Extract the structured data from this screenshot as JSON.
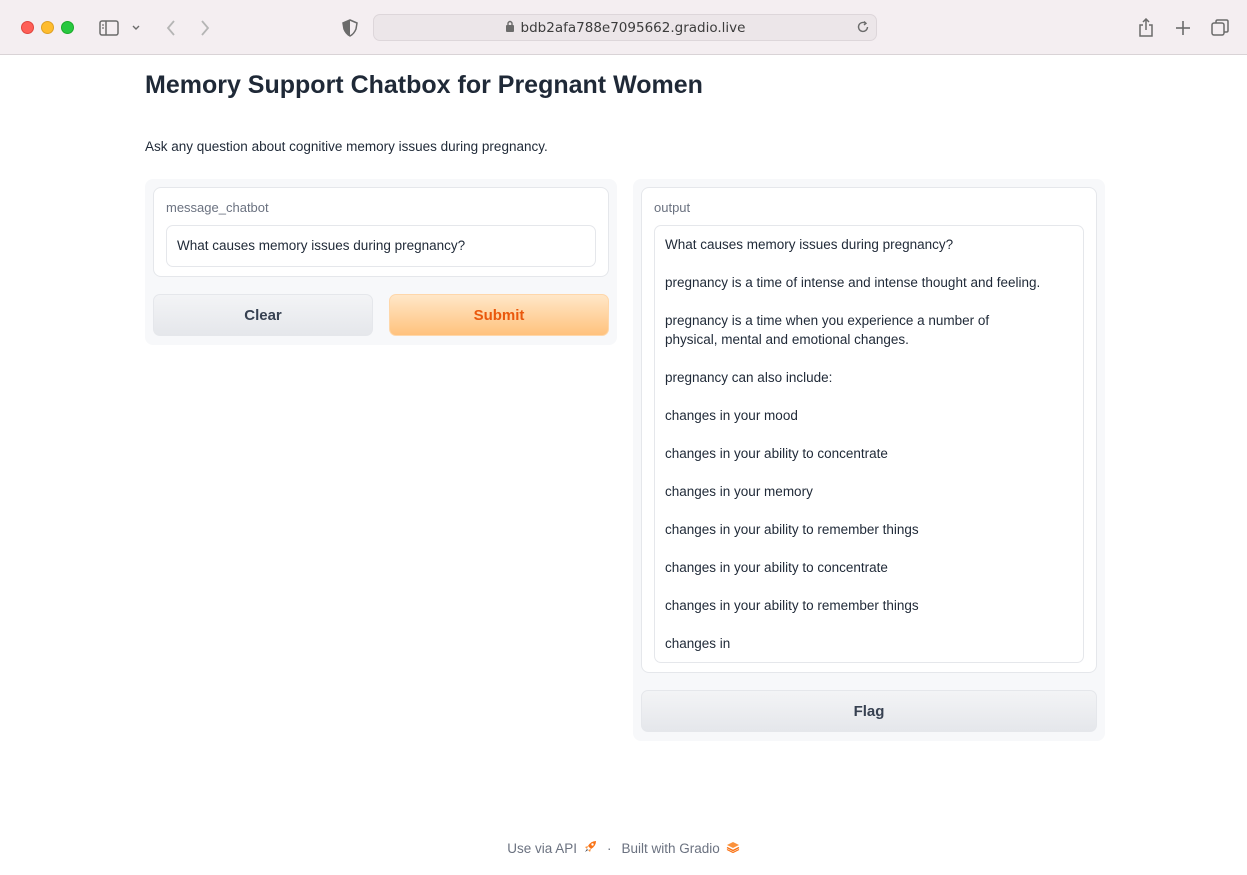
{
  "browser": {
    "url": "bdb2afa788e7095662.gradio.live"
  },
  "page": {
    "title": "Memory Support Chatbox for Pregnant Women",
    "description": "Ask any question about cognitive memory issues during pregnancy."
  },
  "input_panel": {
    "label": "message_chatbot",
    "value": "What causes memory issues during pregnancy?",
    "clear_label": "Clear",
    "submit_label": "Submit"
  },
  "output_panel": {
    "label": "output",
    "lines": [
      "What causes memory issues during pregnancy?",
      "pregnancy is a time of intense and intense thought and feeling.",
      "pregnancy is a time when you experience a number of physical, mental and emotional changes.",
      "pregnancy can also include:",
      "changes in your mood",
      "changes in your ability to concentrate",
      "changes in your memory",
      "changes in your ability to remember things",
      "changes in your ability to concentrate",
      "changes in your ability to remember things",
      "changes in"
    ],
    "flag_label": "Flag"
  },
  "footer": {
    "api_label": "Use via API",
    "separator": "·",
    "built_label": "Built with Gradio"
  },
  "colors": {
    "accent": "#ea580c",
    "submit_bg": "#ffc27d"
  }
}
